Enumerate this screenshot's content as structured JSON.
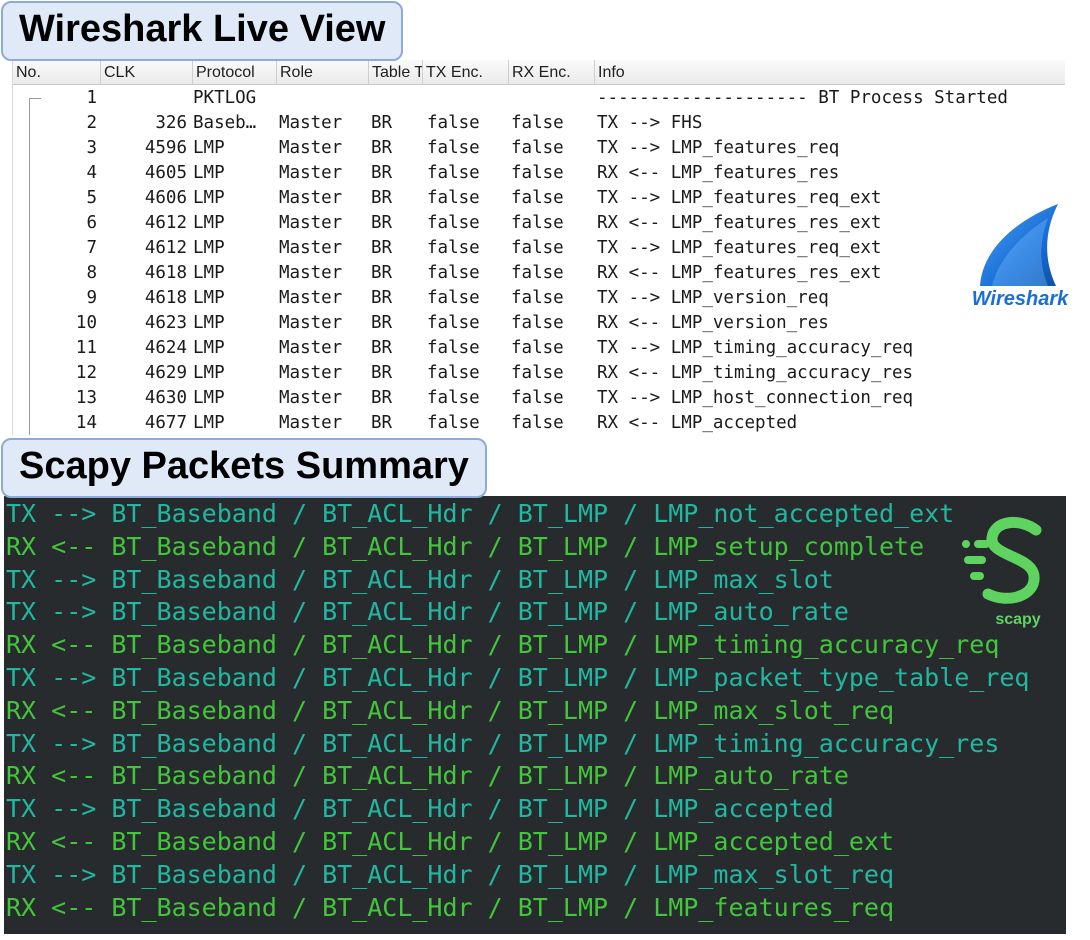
{
  "titles": {
    "wireshark": "Wireshark Live View",
    "scapy": "Scapy Packets Summary"
  },
  "wireshark": {
    "columns": [
      "No.",
      "CLK",
      "Protocol",
      "Role",
      "Table T",
      "TX Enc.",
      "RX Enc.",
      "Info"
    ],
    "rows": [
      {
        "no": "1",
        "clk": "",
        "protocol": "PKTLOG",
        "role": "",
        "table": "",
        "tx": "",
        "rx": "",
        "info": "-------------------- BT Process Started"
      },
      {
        "no": "2",
        "clk": "326",
        "protocol": "Baseb…",
        "role": "Master",
        "table": "BR",
        "tx": "false",
        "rx": "false",
        "info": "TX --> FHS"
      },
      {
        "no": "3",
        "clk": "4596",
        "protocol": "LMP",
        "role": "Master",
        "table": "BR",
        "tx": "false",
        "rx": "false",
        "info": "TX --> LMP_features_req"
      },
      {
        "no": "4",
        "clk": "4605",
        "protocol": "LMP",
        "role": "Master",
        "table": "BR",
        "tx": "false",
        "rx": "false",
        "info": "RX <-- LMP_features_res"
      },
      {
        "no": "5",
        "clk": "4606",
        "protocol": "LMP",
        "role": "Master",
        "table": "BR",
        "tx": "false",
        "rx": "false",
        "info": "TX --> LMP_features_req_ext"
      },
      {
        "no": "6",
        "clk": "4612",
        "protocol": "LMP",
        "role": "Master",
        "table": "BR",
        "tx": "false",
        "rx": "false",
        "info": "RX <-- LMP_features_res_ext"
      },
      {
        "no": "7",
        "clk": "4612",
        "protocol": "LMP",
        "role": "Master",
        "table": "BR",
        "tx": "false",
        "rx": "false",
        "info": "TX --> LMP_features_req_ext"
      },
      {
        "no": "8",
        "clk": "4618",
        "protocol": "LMP",
        "role": "Master",
        "table": "BR",
        "tx": "false",
        "rx": "false",
        "info": "RX <-- LMP_features_res_ext"
      },
      {
        "no": "9",
        "clk": "4618",
        "protocol": "LMP",
        "role": "Master",
        "table": "BR",
        "tx": "false",
        "rx": "false",
        "info": "TX --> LMP_version_req"
      },
      {
        "no": "10",
        "clk": "4623",
        "protocol": "LMP",
        "role": "Master",
        "table": "BR",
        "tx": "false",
        "rx": "false",
        "info": "RX <-- LMP_version_res"
      },
      {
        "no": "11",
        "clk": "4624",
        "protocol": "LMP",
        "role": "Master",
        "table": "BR",
        "tx": "false",
        "rx": "false",
        "info": "TX --> LMP_timing_accuracy_req"
      },
      {
        "no": "12",
        "clk": "4629",
        "protocol": "LMP",
        "role": "Master",
        "table": "BR",
        "tx": "false",
        "rx": "false",
        "info": "RX <-- LMP_timing_accuracy_res"
      },
      {
        "no": "13",
        "clk": "4630",
        "protocol": "LMP",
        "role": "Master",
        "table": "BR",
        "tx": "false",
        "rx": "false",
        "info": "TX --> LMP_host_connection_req"
      },
      {
        "no": "14",
        "clk": "4677",
        "protocol": "LMP",
        "role": "Master",
        "table": "BR",
        "tx": "false",
        "rx": "false",
        "info": "RX <-- LMP_accepted"
      }
    ],
    "logo_text": "Wireshark",
    "logo_colors": {
      "fin_dark": "#0b4fa8",
      "fin_light": "#4aa3f0",
      "text": "#1a6ed8"
    }
  },
  "scapy": {
    "lines": [
      {
        "dir": "tx",
        "text": "TX --> BT_Baseband / BT_ACL_Hdr / BT_LMP / LMP_not_accepted_ext"
      },
      {
        "dir": "rx",
        "text": "RX <-- BT_Baseband / BT_ACL_Hdr / BT_LMP / LMP_setup_complete"
      },
      {
        "dir": "tx",
        "text": "TX --> BT_Baseband / BT_ACL_Hdr / BT_LMP / LMP_max_slot"
      },
      {
        "dir": "tx",
        "text": "TX --> BT_Baseband / BT_ACL_Hdr / BT_LMP / LMP_auto_rate"
      },
      {
        "dir": "rx",
        "text": "RX <-- BT_Baseband / BT_ACL_Hdr / BT_LMP / LMP_timing_accuracy_req"
      },
      {
        "dir": "tx",
        "text": "TX --> BT_Baseband / BT_ACL_Hdr / BT_LMP / LMP_packet_type_table_req"
      },
      {
        "dir": "rx",
        "text": "RX <-- BT_Baseband / BT_ACL_Hdr / BT_LMP / LMP_max_slot_req"
      },
      {
        "dir": "tx",
        "text": "TX --> BT_Baseband / BT_ACL_Hdr / BT_LMP / LMP_timing_accuracy_res"
      },
      {
        "dir": "rx",
        "text": "RX <-- BT_Baseband / BT_ACL_Hdr / BT_LMP / LMP_auto_rate"
      },
      {
        "dir": "tx",
        "text": "TX --> BT_Baseband / BT_ACL_Hdr / BT_LMP / LMP_accepted"
      },
      {
        "dir": "rx",
        "text": "RX <-- BT_Baseband / BT_ACL_Hdr / BT_LMP / LMP_accepted_ext"
      },
      {
        "dir": "tx",
        "text": "TX --> BT_Baseband / BT_ACL_Hdr / BT_LMP / LMP_max_slot_req"
      },
      {
        "dir": "rx",
        "text": "RX <-- BT_Baseband / BT_ACL_Hdr / BT_LMP / LMP_features_req"
      }
    ],
    "logo_text": "scapy",
    "colors": {
      "tx": "#21b7a0",
      "rx": "#43c53c",
      "background": "#272b2e",
      "logo": "#5fd35f"
    }
  }
}
